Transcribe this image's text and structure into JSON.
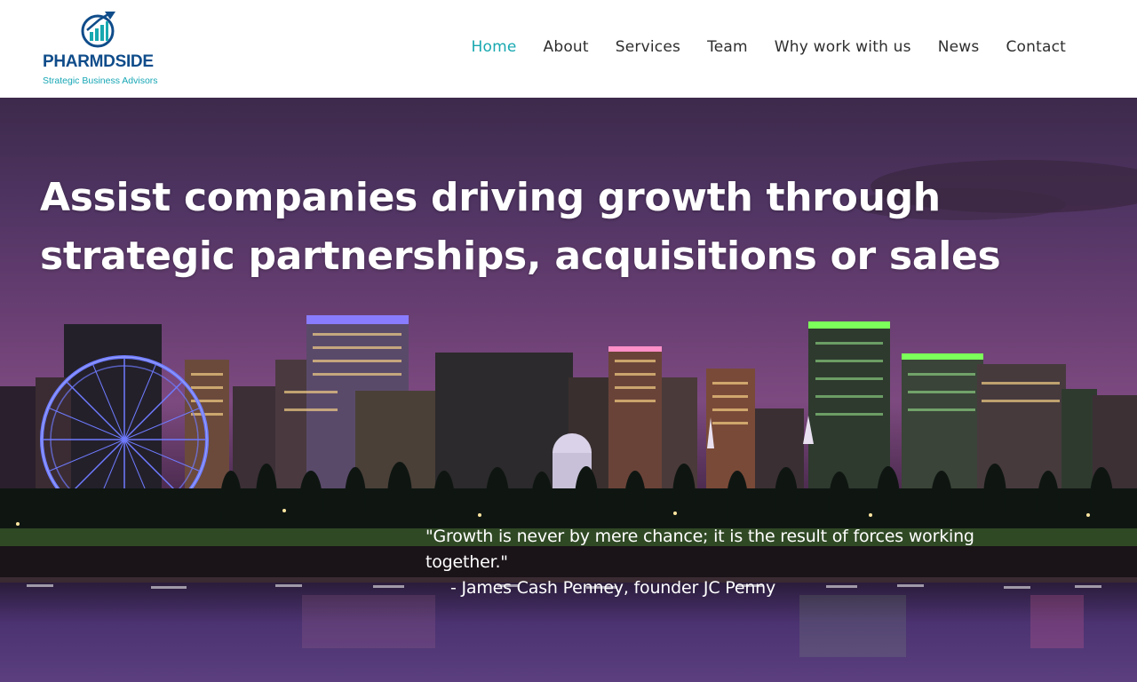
{
  "brand": {
    "name": "PHARMDSIDE",
    "tagline": "Strategic Business Advisors",
    "logo_icon": "chart-arrow-circle-icon",
    "colors": {
      "primary": "#0f4c8a",
      "accent": "#17a8b0"
    }
  },
  "nav": {
    "items": [
      {
        "label": "Home",
        "active": true
      },
      {
        "label": "About",
        "active": false
      },
      {
        "label": "Services",
        "active": false
      },
      {
        "label": "Team",
        "active": false
      },
      {
        "label": "Why work with us",
        "active": false
      },
      {
        "label": "News",
        "active": false
      },
      {
        "label": "Contact",
        "active": false
      }
    ]
  },
  "hero": {
    "headline_line1": "Assist companies driving growth through",
    "headline_line2": "strategic partnerships, acquisitions or sales",
    "quote_text": "\"Growth is never by mere chance; it is the result of forces working together.\"",
    "quote_author": "- James Cash Penney, founder JC Penny",
    "background": "city-skyline-night-image"
  }
}
